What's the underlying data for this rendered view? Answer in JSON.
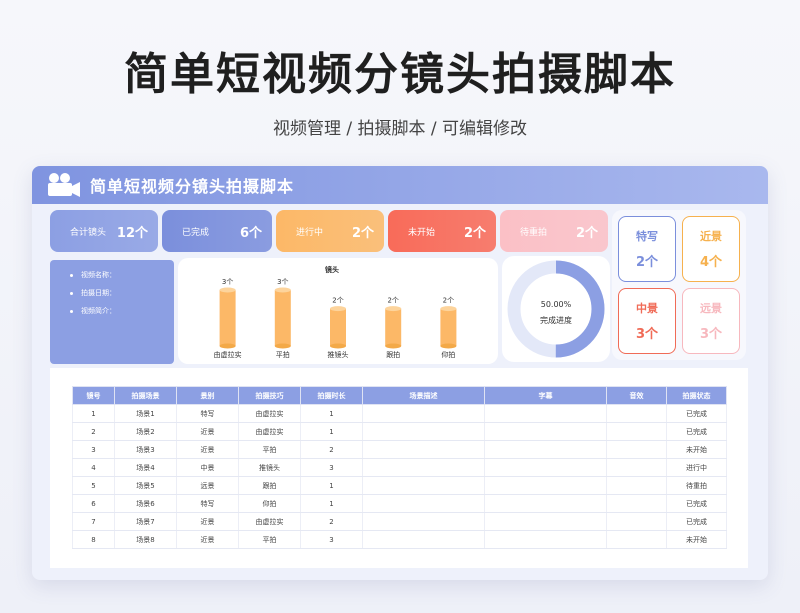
{
  "page": {
    "title": "简单短视频分镜头拍摄脚本",
    "subtitle": "视频管理 / 拍摄脚本 /  可编辑修改"
  },
  "header": {
    "title": "简单短视频分镜头拍摄脚本",
    "icon": "camera-icon"
  },
  "stats": [
    {
      "label": "合计镜头",
      "value": "12个",
      "color": "#8c9fe3"
    },
    {
      "label": "已完成",
      "value": "6个",
      "color": "#7b8fdc"
    },
    {
      "label": "进行中",
      "value": "2个",
      "color": "#fcb867"
    },
    {
      "label": "未开始",
      "value": "2个",
      "color": "#f86b59"
    },
    {
      "label": "待重拍",
      "value": "2个",
      "color": "#fbc0c6"
    }
  ],
  "tiles": [
    {
      "label": "特写",
      "value": "2个",
      "color": "#7b8fdc"
    },
    {
      "label": "近景",
      "value": "4个",
      "color": "#f6b14e"
    },
    {
      "label": "中景",
      "value": "3个",
      "color": "#f06b57"
    },
    {
      "label": "远景",
      "value": "3个",
      "color": "#f7b8be"
    }
  ],
  "info": {
    "items": [
      "视频名称：",
      "拍摄日期：",
      "视频简介："
    ]
  },
  "chart_data": {
    "type": "bar",
    "title": "镜头",
    "categories": [
      "由虚拉实",
      "平拍",
      "推镜头",
      "跟拍",
      "仰拍"
    ],
    "series": [
      {
        "values": [
          3,
          3,
          2,
          2,
          2
        ]
      }
    ],
    "data_labels": [
      "3个",
      "3个",
      "2个",
      "2个",
      "2个"
    ],
    "ylim": [
      0,
      3
    ],
    "color": "#fcb867"
  },
  "progress": {
    "percent_text": "50.00%",
    "label": "完成进度",
    "value": 0.5,
    "color": "#8c9fe3",
    "track_color": "#e3e8f8"
  },
  "table": {
    "headers": [
      "镜号",
      "拍摄场景",
      "景别",
      "拍摄技巧",
      "拍摄时长",
      "场景描述",
      "字幕",
      "音效",
      "拍摄状态"
    ],
    "rows": [
      [
        "1",
        "场景1",
        "特写",
        "由虚拉实",
        "1",
        "",
        "",
        "",
        "已完成"
      ],
      [
        "2",
        "场景2",
        "近景",
        "由虚拉实",
        "1",
        "",
        "",
        "",
        "已完成"
      ],
      [
        "3",
        "场景3",
        "近景",
        "平拍",
        "2",
        "",
        "",
        "",
        "未开始"
      ],
      [
        "4",
        "场景4",
        "中景",
        "推镜头",
        "3",
        "",
        "",
        "",
        "进行中"
      ],
      [
        "5",
        "场景5",
        "远景",
        "跟拍",
        "1",
        "",
        "",
        "",
        "待重拍"
      ],
      [
        "6",
        "场景6",
        "特写",
        "仰拍",
        "1",
        "",
        "",
        "",
        "已完成"
      ],
      [
        "7",
        "场景7",
        "近景",
        "由虚拉实",
        "2",
        "",
        "",
        "",
        "已完成"
      ],
      [
        "8",
        "场景8",
        "近景",
        "平拍",
        "3",
        "",
        "",
        "",
        "未开始"
      ]
    ]
  }
}
